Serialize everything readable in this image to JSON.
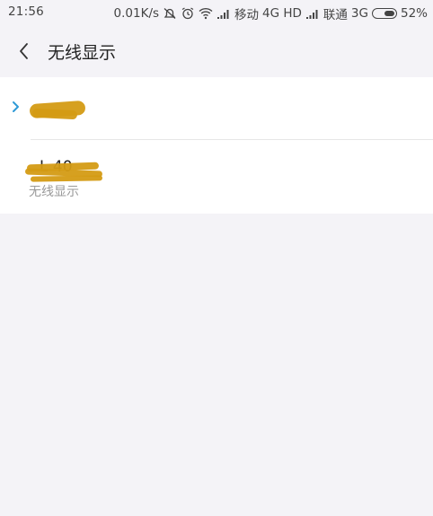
{
  "status_bar": {
    "time": "21:56",
    "speed": "0.01K/s",
    "carrier1": "移动",
    "network1": "4G HD",
    "carrier2": "联通",
    "network2": "3G",
    "battery_percent": "52%",
    "battery_level": 0.52,
    "icons": [
      "mute-icon",
      "alarm-icon",
      "wifi-icon",
      "signal-icon",
      "signal-icon",
      "battery-icon"
    ]
  },
  "header": {
    "title": "无线显示",
    "back_icon": "chevron-left-icon"
  },
  "devices": [
    {
      "name": "",
      "connected": true,
      "indicator_icon": "chevron-right-icon",
      "accent": "#2e9ad6"
    },
    {
      "name": "L 40",
      "subtitle": "无线显示"
    }
  ],
  "colors": {
    "background": "#f4f3f7",
    "card": "#ffffff",
    "accent": "#2e9ad6",
    "redaction": "#d49b14"
  }
}
